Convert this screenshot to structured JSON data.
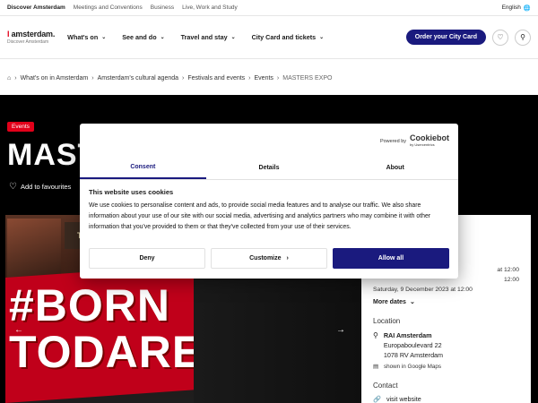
{
  "utilbar": {
    "links": [
      "Discover Amsterdam",
      "Meetings and Conventions",
      "Business",
      "Live, Work and Study"
    ],
    "language": "English"
  },
  "header": {
    "logo_main_prefix": "I",
    "logo_main": "amsterdam.",
    "logo_sub": "Discover Amsterdam",
    "nav": [
      "What's on",
      "See and do",
      "Travel and stay",
      "City Card and tickets"
    ],
    "cta": "Order your City Card"
  },
  "breadcrumb": [
    "What's on in Amsterdam",
    "Amsterdam's cultural agenda",
    "Festivals and events",
    "Events",
    "MASTERS EXPO"
  ],
  "hero": {
    "badge": "Events",
    "title": "MAST",
    "favourites": "Add to favourites",
    "poster_brand": "TUDOR",
    "slogan_line1": "#BORN",
    "slogan_line2": "TODARE"
  },
  "sidebar": {
    "date_lines": [
      "at 12:00",
      "12:00",
      "Saturday, 9 December 2023 at 12:00"
    ],
    "more_dates": "More dates",
    "location_heading": "Location",
    "venue": "RAI Amsterdam",
    "street": "Europaboulevard 22",
    "city": "1078 RV Amsterdam",
    "maps": "shown in Google Maps",
    "contact_heading": "Contact",
    "website": "visit website"
  },
  "cookie": {
    "powered_by": "Powered by",
    "brand": "Cookiebot",
    "brand_sub": "by Usercentrics",
    "tabs": [
      "Consent",
      "Details",
      "About"
    ],
    "heading": "This website uses cookies",
    "body": "We use cookies to personalise content and ads, to provide social media features and to analyse our traffic. We also share information about your use of our site with our social media, advertising and analytics partners who may combine it with other information that you've provided to them or that they've collected from your use of their services.",
    "deny": "Deny",
    "customize": "Customize",
    "allow": "Allow all"
  }
}
